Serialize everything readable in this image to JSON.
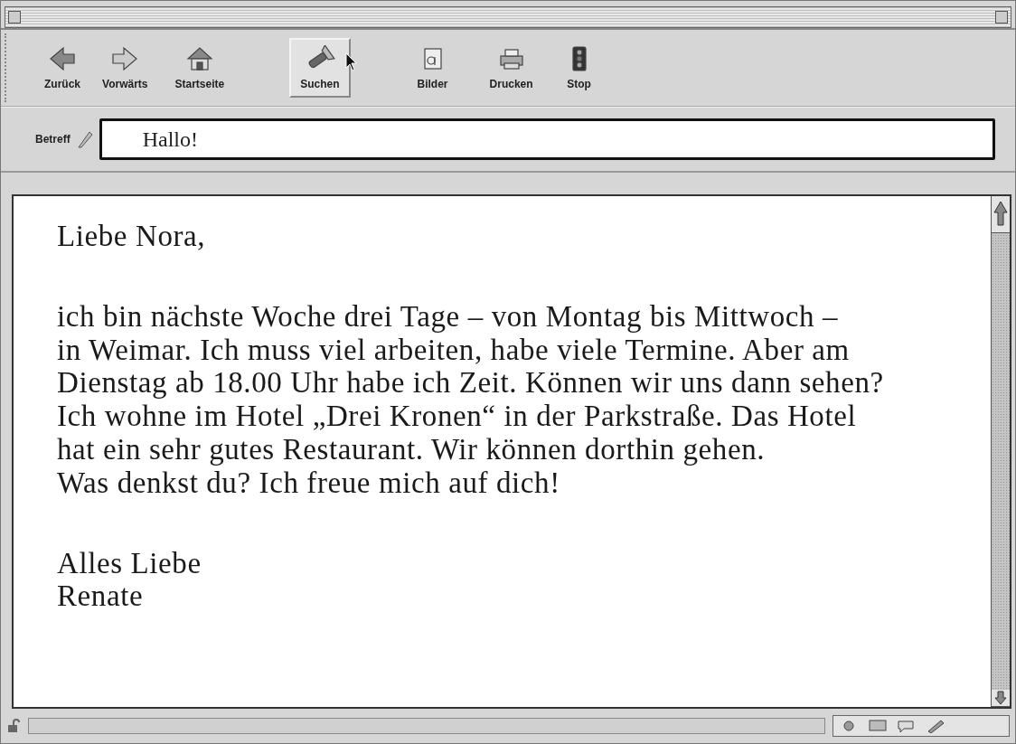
{
  "toolbar": {
    "buttons": [
      {
        "label": "Zurück",
        "selected": false
      },
      {
        "label": "Vorwärts",
        "selected": false
      },
      {
        "label": "Startseite",
        "selected": false
      },
      {
        "label": "Suchen",
        "selected": true
      },
      {
        "label": "Bilder",
        "selected": false
      },
      {
        "label": "Drucken",
        "selected": false
      },
      {
        "label": "Stop",
        "selected": false
      }
    ]
  },
  "status": {
    "progress": {
      "level": 0
    }
  },
  "subject": {
    "label": "Betreff",
    "value": "Hallo!"
  },
  "message": {
    "paragraphs": [
      {
        "lines": [
          "Liebe Nora,"
        ]
      },
      {
        "lines": [
          "ich bin nächste Woche drei Tage – von Montag bis Mittwoch –",
          "in Weimar. Ich muss viel arbeiten, habe viele Termine. Aber am",
          "Dienstag ab 18.00 Uhr habe ich Zeit. Können wir uns dann sehen?",
          "Ich wohne im Hotel „Drei Kronen“ in der Parkstraße. Das Hotel",
          "hat ein sehr gutes Restaurant. Wir können dorthin gehen.",
          "Was denkst du? Ich freue mich auf dich!"
        ]
      },
      {
        "lines": [
          "Alles Liebe",
          "Renate"
        ]
      }
    ]
  }
}
